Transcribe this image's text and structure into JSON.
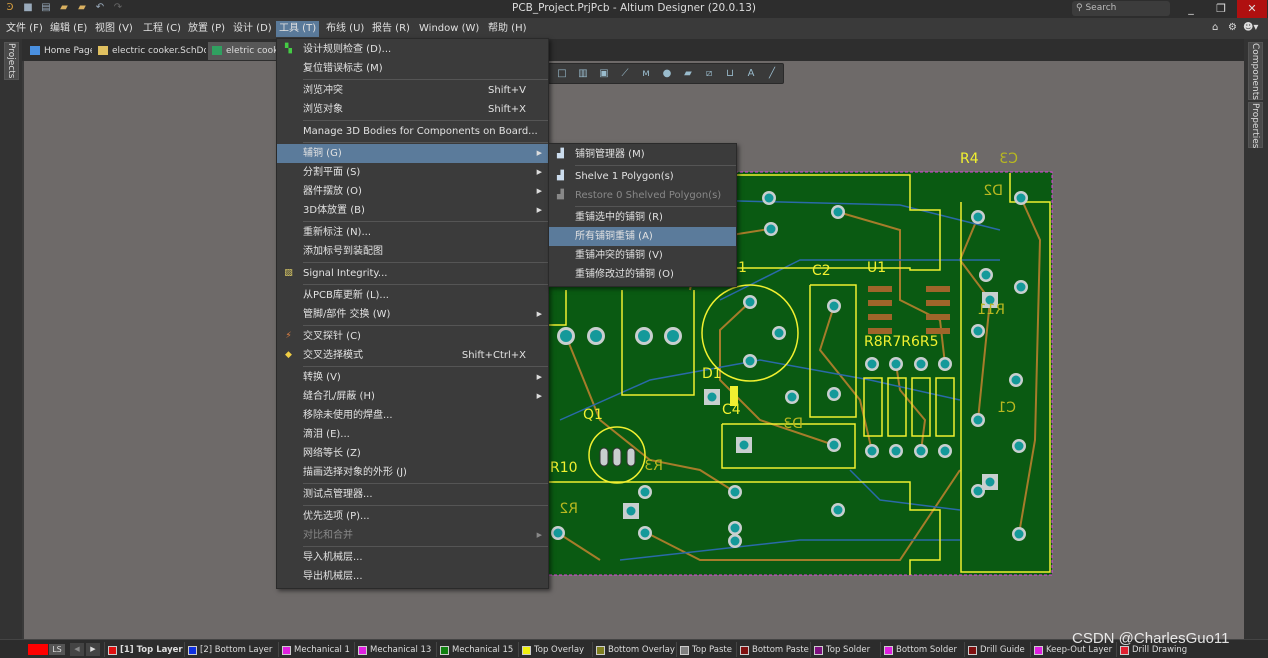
{
  "window": {
    "title": "PCB_Project.PrjPcb - Altium Designer (20.0.13)",
    "search_placeholder": "Search",
    "minimize": "_",
    "restore": "❐",
    "close": "✕"
  },
  "menubar": [
    {
      "label": "文件 (F)"
    },
    {
      "label": "编辑 (E)"
    },
    {
      "label": "视图 (V)"
    },
    {
      "label": "工程 (C)"
    },
    {
      "label": "放置 (P)"
    },
    {
      "label": "设计 (D)"
    },
    {
      "label": "工具 (T)",
      "active": true
    },
    {
      "label": "布线 (U)"
    },
    {
      "label": "报告 (R)"
    },
    {
      "label": "Window (W)"
    },
    {
      "label": "帮助 (H)"
    }
  ],
  "doc_tabs": [
    {
      "label": "Home Page",
      "icon": "home-icon"
    },
    {
      "label": "electric cooker.SchDoc *",
      "icon": "schematic-icon"
    },
    {
      "label": "eletric cooker",
      "icon": "pcb-icon",
      "selected": true
    }
  ],
  "side_panels": {
    "left": "Projects",
    "right": [
      "Components",
      "Properties"
    ]
  },
  "tools_menu": [
    {
      "label": "设计规则检查 (D)...",
      "icon": "drc-icon"
    },
    {
      "label": "复位错误标志 (M)"
    },
    {
      "separator": true
    },
    {
      "label": "浏览冲突",
      "shortcut": "Shift+V"
    },
    {
      "label": "浏览对象",
      "shortcut": "Shift+X"
    },
    {
      "separator": true
    },
    {
      "label": "Manage 3D Bodies for Components on Board..."
    },
    {
      "separator": true
    },
    {
      "label": "辅铜 (G)",
      "submenu": true,
      "highlighted": true
    },
    {
      "label": "分割平面 (S)",
      "submenu": true
    },
    {
      "label": "器件摆放 (O)",
      "submenu": true
    },
    {
      "label": "3D体放置 (B)",
      "submenu": true
    },
    {
      "separator": true
    },
    {
      "label": "重新标注 (N)..."
    },
    {
      "label": "添加标号到装配图"
    },
    {
      "separator": true
    },
    {
      "label": "Signal Integrity...",
      "icon": "signal-integrity-icon"
    },
    {
      "separator": true
    },
    {
      "label": "从PCB库更新 (L)..."
    },
    {
      "label": "管脚/部件 交换 (W)",
      "submenu": true
    },
    {
      "separator": true
    },
    {
      "label": "交叉探针 (C)",
      "icon": "cross-probe-icon"
    },
    {
      "label": "交叉选择模式",
      "shortcut": "Shift+Ctrl+X",
      "icon": "cross-select-icon"
    },
    {
      "separator": true
    },
    {
      "label": "转换 (V)",
      "submenu": true
    },
    {
      "label": "缝合孔/屏蔽 (H)",
      "submenu": true
    },
    {
      "label": "移除未使用的焊盘..."
    },
    {
      "label": "滴泪 (E)..."
    },
    {
      "label": "网络等长 (Z)"
    },
    {
      "label": "描画选择对象的外形 (J)"
    },
    {
      "separator": true
    },
    {
      "label": "测试点管理器..."
    },
    {
      "separator": true
    },
    {
      "label": "优先选项 (P)..."
    },
    {
      "label": "对比和合并",
      "submenu": true,
      "disabled": true
    },
    {
      "separator": true
    },
    {
      "label": "导入机械层..."
    },
    {
      "label": "导出机械层..."
    }
  ],
  "polygon_submenu": [
    {
      "label": "铺铜管理器 (M)",
      "icon": "polygon-icon"
    },
    {
      "separator": true
    },
    {
      "label": "Shelve 1 Polygon(s)",
      "icon": "polygon-icon"
    },
    {
      "label": "Restore 0 Shelved Polygon(s)",
      "icon": "polygon-icon",
      "disabled": true
    },
    {
      "separator": true
    },
    {
      "label": "重铺选中的铺铜 (R)"
    },
    {
      "label": "所有铺铜重铺 (A)",
      "highlighted": true
    },
    {
      "label": "重铺冲突的铺铜 (V)"
    },
    {
      "label": "重铺修改过的铺铜 (O)"
    }
  ],
  "pcb_toolbar": [
    "select-rect-icon",
    "place-component-icon",
    "place-pad-icon",
    "route-icon",
    "interactive-diff-icon",
    "place-via-icon",
    "polygon-icon",
    "keepout-icon",
    "dimension-icon",
    "text-icon",
    "line-icon"
  ],
  "pcb": {
    "designators": [
      "R4",
      "C3",
      "D2",
      "C2",
      "U1",
      "R8R7R6R5",
      "D1",
      "C4",
      "Q1",
      "R10",
      "R3",
      "D3",
      "R11",
      "C1",
      "R2",
      "1"
    ],
    "colors": {
      "board": "#0a5a12",
      "overlay": "#f0f030",
      "top_trace": "#a67c2a",
      "bottom_trace": "#2a6aa8",
      "pad": "#14999a",
      "keepout": "#e040e0"
    }
  },
  "statusbar": {
    "ls_label": "LS",
    "layers": [
      {
        "label": "[1] Top Layer",
        "color": "#e01010",
        "current": true
      },
      {
        "label": "[2] Bottom Layer",
        "color": "#1030e0"
      },
      {
        "label": "Mechanical 1",
        "color": "#e020e0"
      },
      {
        "label": "Mechanical 13",
        "color": "#e020e0"
      },
      {
        "label": "Mechanical 15",
        "color": "#108010"
      },
      {
        "label": "Top Overlay",
        "color": "#f0f010"
      },
      {
        "label": "Bottom Overlay",
        "color": "#808020"
      },
      {
        "label": "Top Paste",
        "color": "#808080"
      },
      {
        "label": "Bottom Paste",
        "color": "#801010"
      },
      {
        "label": "Top Solder",
        "color": "#801080"
      },
      {
        "label": "Bottom Solder",
        "color": "#e020e0"
      },
      {
        "label": "Drill Guide",
        "color": "#801010"
      },
      {
        "label": "Keep-Out Layer",
        "color": "#e020e0"
      },
      {
        "label": "Drill Drawing",
        "color": "#e02030"
      }
    ]
  },
  "watermark": "CSDN @CharlesGuo11"
}
